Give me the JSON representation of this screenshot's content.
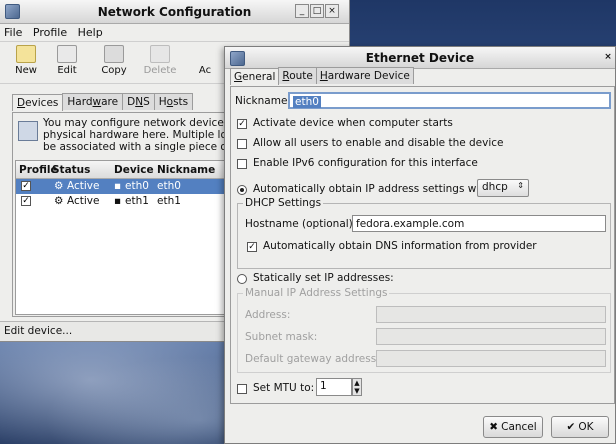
{
  "net": {
    "title": "Network Configuration",
    "menu": [
      "File",
      "Profile",
      "Help"
    ],
    "toolbar": [
      "New",
      "Edit",
      "Copy",
      "Delete",
      "Ac"
    ],
    "tabs": [
      "Devices",
      "Hardware",
      "DNS",
      "Hosts"
    ],
    "info": [
      "You may configure network device",
      "physical hardware here.  Multiple lo",
      "be associated with a single piece o"
    ],
    "table": {
      "headers": [
        "Profile",
        "Status",
        "Device",
        "Nickname"
      ],
      "rows": [
        {
          "status": "Active",
          "device": "eth0",
          "nickname": "eth0"
        },
        {
          "status": "Active",
          "device": "eth1",
          "nickname": "eth1"
        }
      ]
    },
    "status": "Edit device..."
  },
  "eth": {
    "title": "Ethernet Device",
    "tabs": [
      "General",
      "Route",
      "Hardware Device"
    ],
    "nickname_label": "Nickname:",
    "nickname_value": "eth0",
    "activate_label": "Activate device when computer starts",
    "allow_users_label": "Allow all users to enable and disable the device",
    "ipv6_label": "Enable IPv6 configuration for this interface",
    "auto_ip_label": "Automatically obtain IP address settings with:",
    "auto_ip_method": "dhcp",
    "dhcp_settings_label": "DHCP Settings",
    "hostname_label": "Hostname (optional):",
    "hostname_value": "fedora.example.com",
    "auto_dns_label": "Automatically obtain DNS information from provider",
    "static_label": "Statically set IP addresses:",
    "manual_label": "Manual IP Address Settings",
    "address_label": "Address:",
    "subnet_label": "Subnet mask:",
    "gateway_label": "Default gateway address:",
    "mtu_label": "Set MTU to:",
    "mtu_value": "1",
    "cancel": "Cancel",
    "ok": "OK"
  }
}
